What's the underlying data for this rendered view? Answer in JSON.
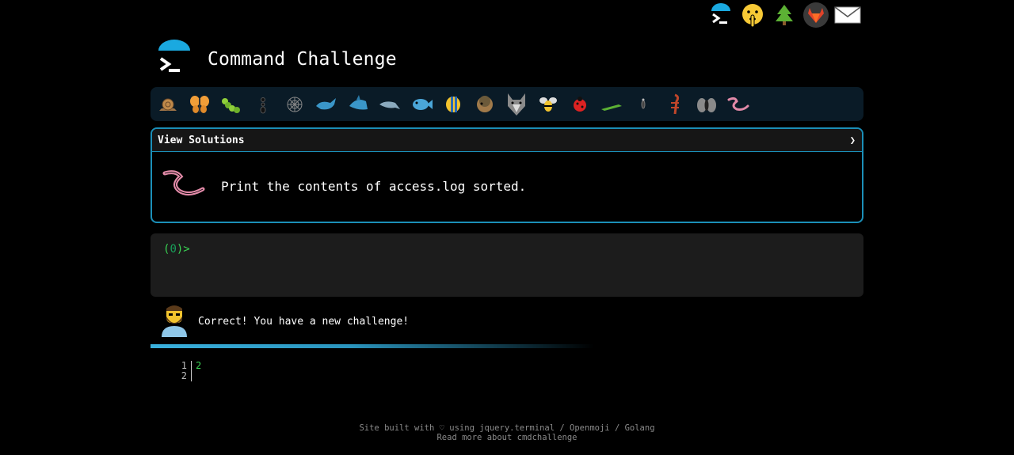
{
  "app": {
    "title": "Command Challenge"
  },
  "top_icons": [
    "terminal-icon",
    "shushing-face-icon",
    "evergreen-tree-icon",
    "gitlab-icon",
    "envelope-icon"
  ],
  "bugs": [
    "snail-icon",
    "butterfly-icon",
    "caterpillar-icon",
    "ant-icon",
    "spider-web-icon",
    "whale-icon",
    "shark-icon",
    "dolphin-icon",
    "fish-icon",
    "tropical-fish-icon",
    "blowfish-icon",
    "wolf-icon",
    "bee-icon",
    "ladybug-icon",
    "cricket-icon",
    "mosquito-icon",
    "scorpion-icon",
    "fly-icon",
    "worm-icon"
  ],
  "challenge": {
    "view_solutions_label": "View Solutions",
    "toggle_arrow": "❯",
    "task_text": "Print the contents of access.log sorted.",
    "task_icon": "worm-icon"
  },
  "terminal": {
    "prompt_open": "(",
    "prompt_num": "0",
    "prompt_close": ")>"
  },
  "feedback": {
    "text": "Correct! You have a new challenge!",
    "avatar": "bearded-person-icon"
  },
  "progress": {
    "value_percent": 44,
    "color": "#3ab0dd"
  },
  "output": {
    "line_numbers": [
      "1",
      "2"
    ],
    "lines": [
      "2",
      ""
    ]
  },
  "footer": {
    "line1_prefix": "Site built with",
    "heart": "♡",
    "line1_using": "using",
    "links": [
      "jquery.terminal",
      "Openmoji",
      "Golang"
    ],
    "separator": "/",
    "line2": "Read more about cmdchallenge"
  },
  "colors": {
    "accent": "#1b8fb8",
    "prompt_green": "#39d353",
    "bug_bar_bg": "#0a1b27",
    "terminal_bg": "#1c1c1c"
  }
}
